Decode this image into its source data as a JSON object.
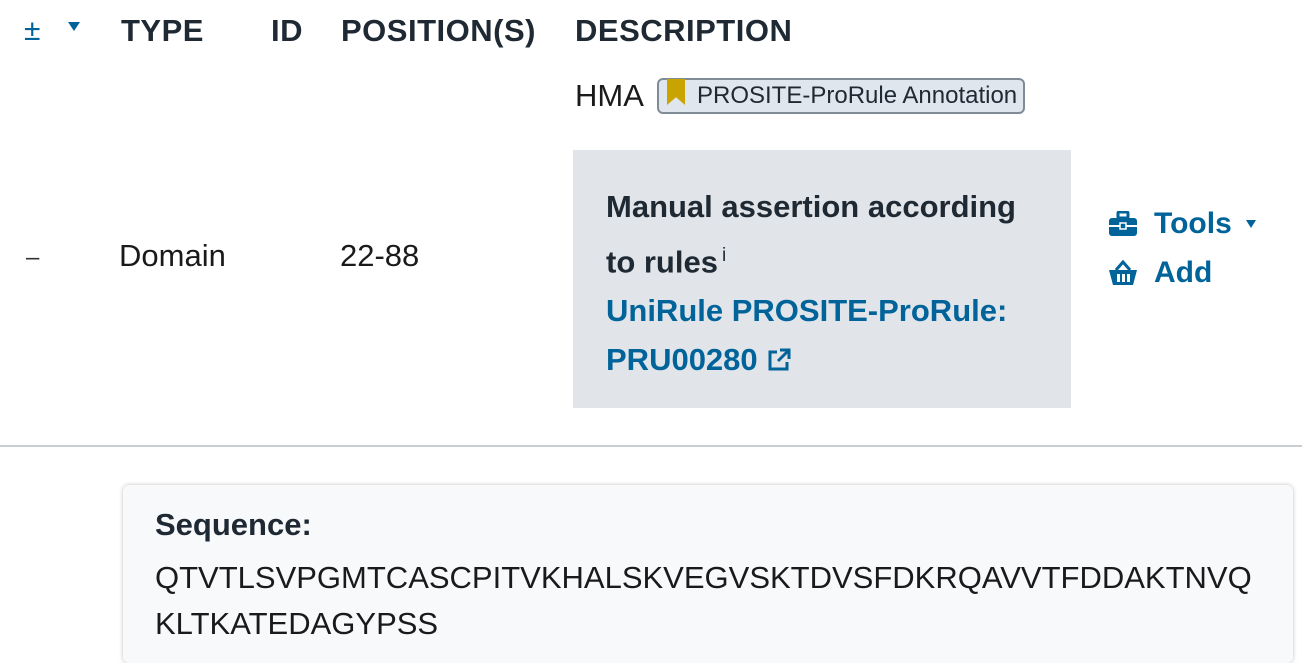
{
  "header": {
    "expand_symbol": "±",
    "type": "TYPE",
    "id": "ID",
    "positions": "POSITION(S)",
    "description": "DESCRIPTION"
  },
  "row": {
    "collapse_symbol": "–",
    "type": "Domain",
    "position": "22-88",
    "description_name": "HMA",
    "badge_label": "PROSITE-ProRule Annotation",
    "evidence": {
      "assertion": "Manual assertion according to rules",
      "info_mark": "i",
      "source_link": "UniRule PROSITE-ProRule: PRU00280"
    }
  },
  "actions": {
    "tools_label": "Tools",
    "add_label": "Add"
  },
  "sequence": {
    "title": "Sequence:",
    "value": "QTVTLSVPGMTCASCPITVKHALSKVEGVSKTDVSFDKRQAVVTFDDAKTNVQKLTKATEDAGYPSS"
  },
  "icons": {
    "badge": "bookmark-icon",
    "tools": "toolbox-icon",
    "add": "basket-icon",
    "link": "external-link-icon"
  },
  "colors": {
    "link": "#00639a",
    "badge_bookmark": "#c9a400",
    "evidence_bg": "#e1e4e8"
  }
}
